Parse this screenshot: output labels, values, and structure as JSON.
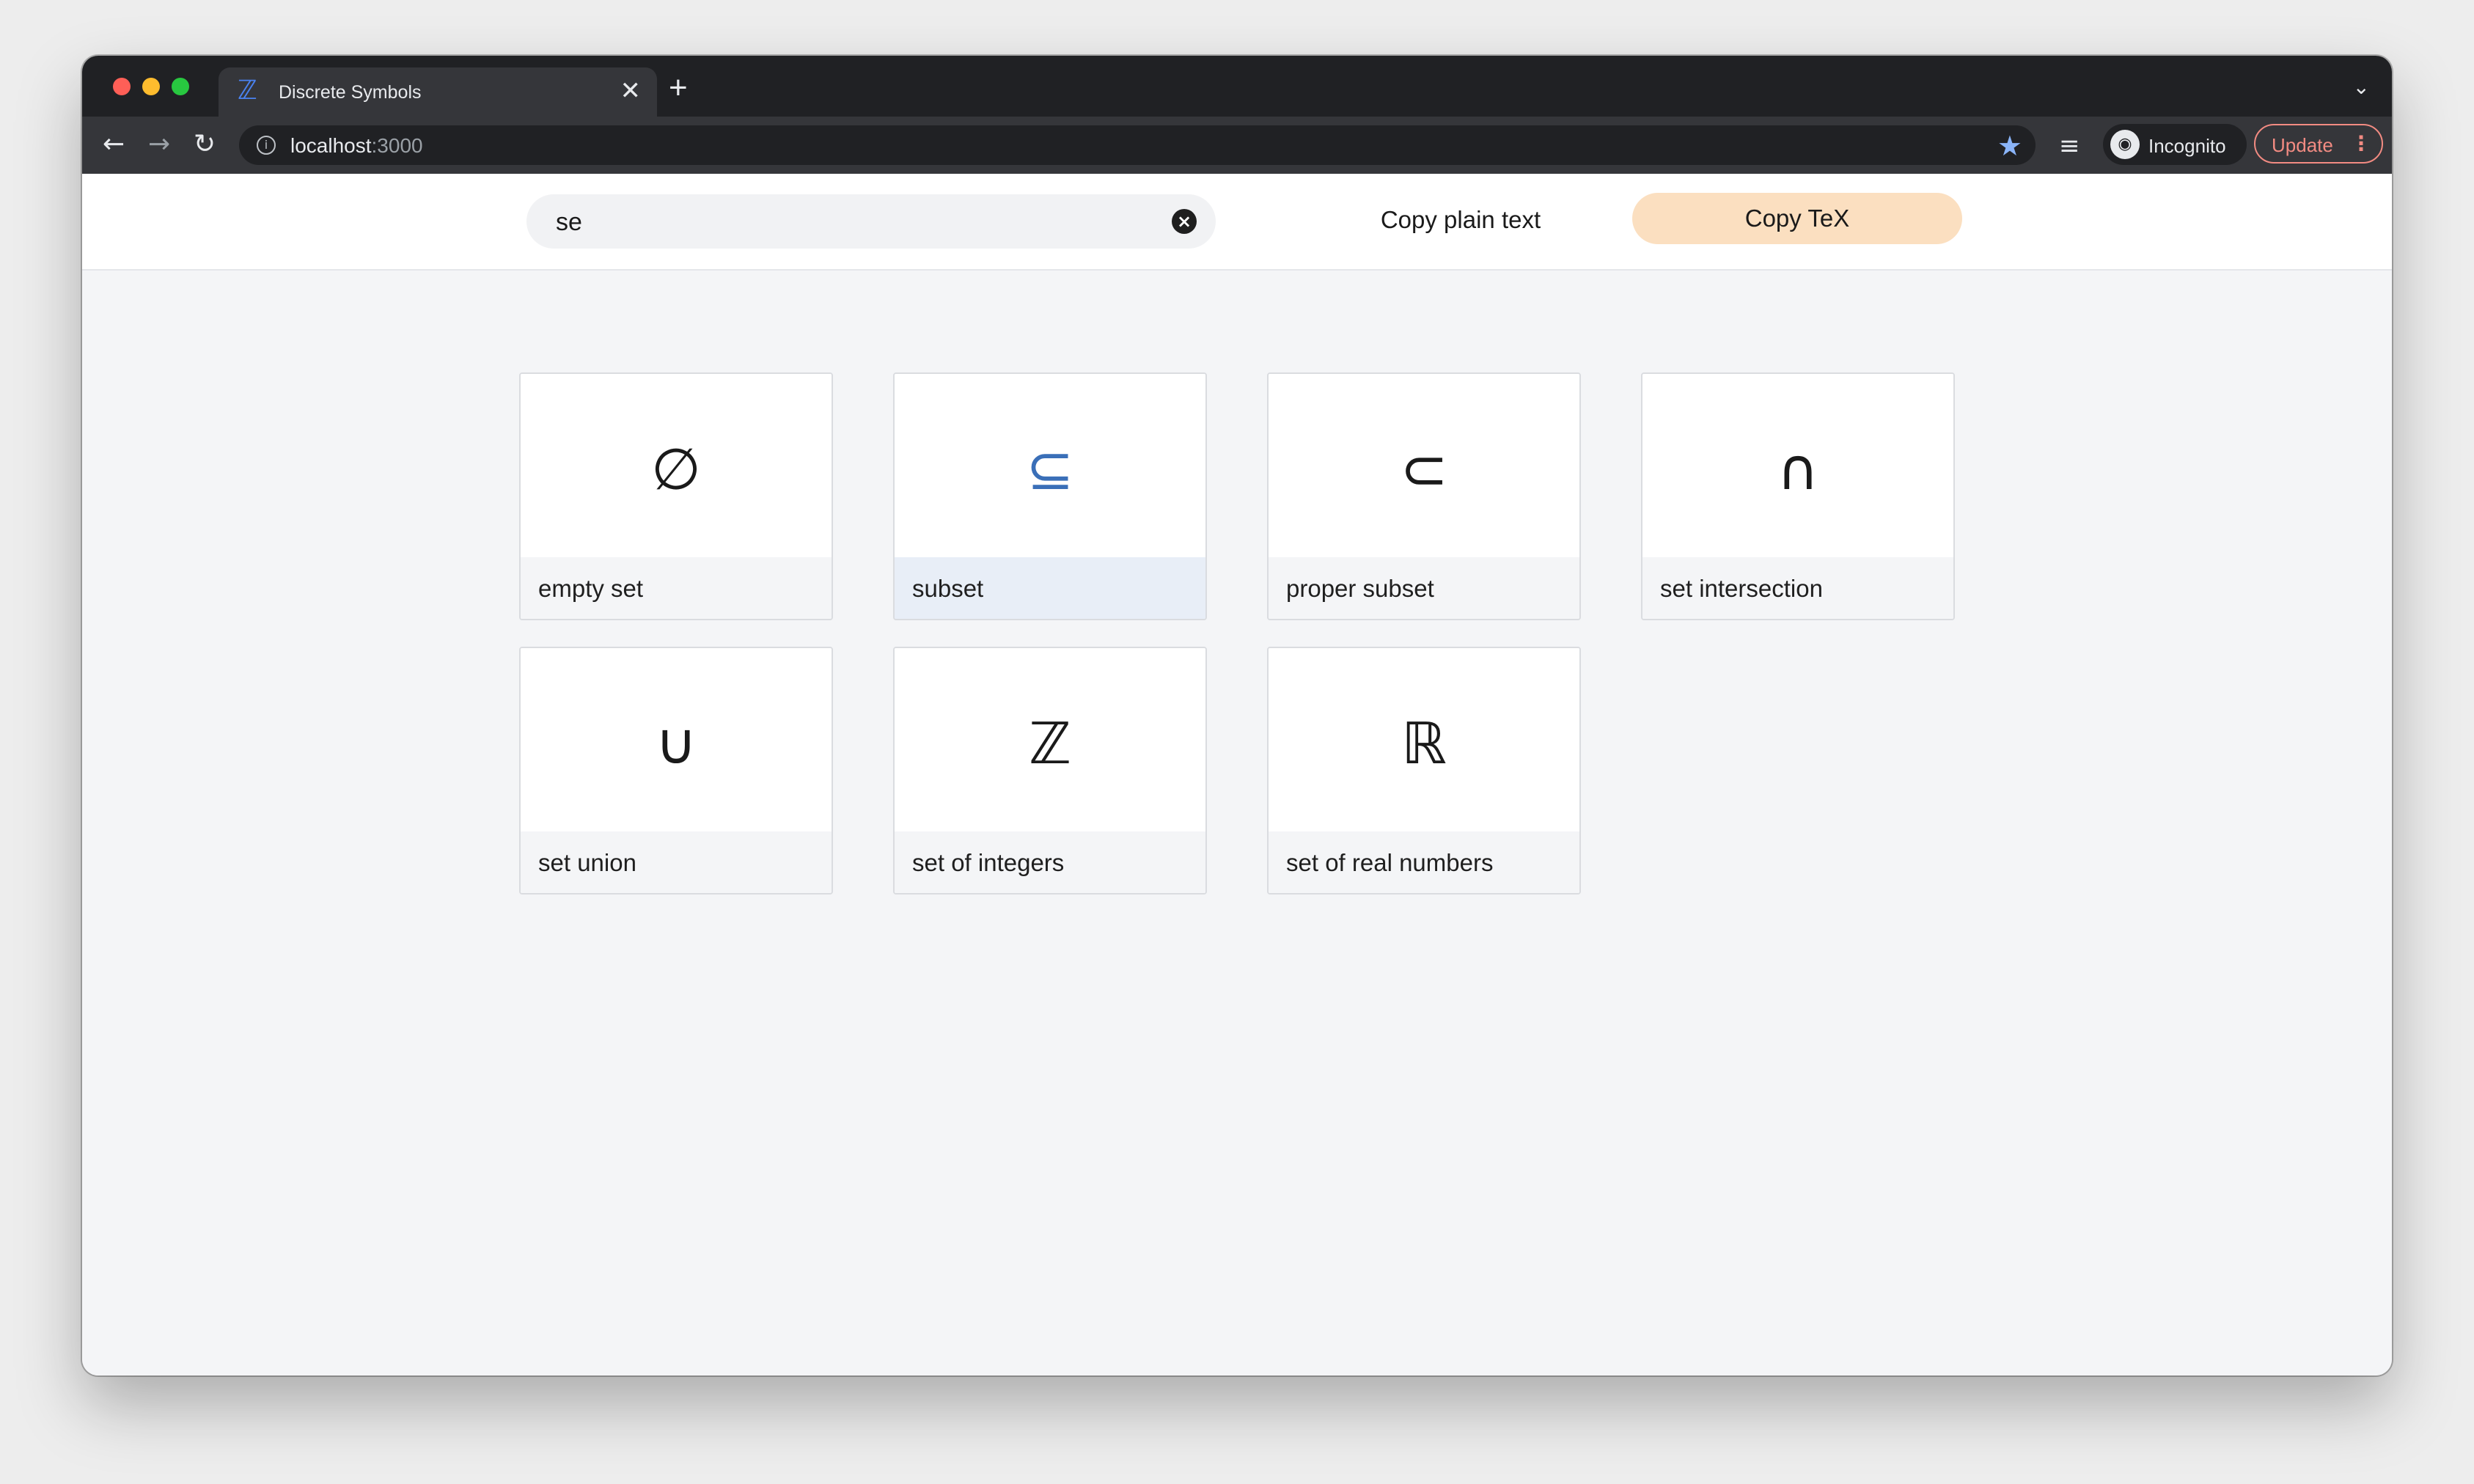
{
  "browser": {
    "tab": {
      "favicon": "ℤ",
      "title": "Discrete Symbols",
      "close": "✕"
    },
    "new_tab": "+",
    "tab_menu": "⌄",
    "nav": {
      "back": "←",
      "forward": "→",
      "reload": "↻"
    },
    "url": {
      "host": "localhost",
      "port": ":3000"
    },
    "incognito_label": "Incognito",
    "update_label": "Update",
    "accent_color": "#8ab4f8"
  },
  "search": {
    "value": "se",
    "placeholder": ""
  },
  "actions": {
    "copy_plain_label": "Copy plain text",
    "copy_tex_label": "Copy TeX",
    "copy_tex_color": "#fbdfc0"
  },
  "symbols": [
    {
      "glyph": "∅",
      "label": "empty set",
      "selected": false
    },
    {
      "glyph": "⊆",
      "label": "subset",
      "selected": true
    },
    {
      "glyph": "⊂",
      "label": "proper subset",
      "selected": false
    },
    {
      "glyph": "∩",
      "label": "set intersection",
      "selected": false
    },
    {
      "glyph": "∪",
      "label": "set union",
      "selected": false
    },
    {
      "glyph": "ℤ",
      "label": "set of integers",
      "selected": false
    },
    {
      "glyph": "ℝ",
      "label": "set of real numbers",
      "selected": false
    }
  ],
  "selected_color": "#3a6fb8"
}
